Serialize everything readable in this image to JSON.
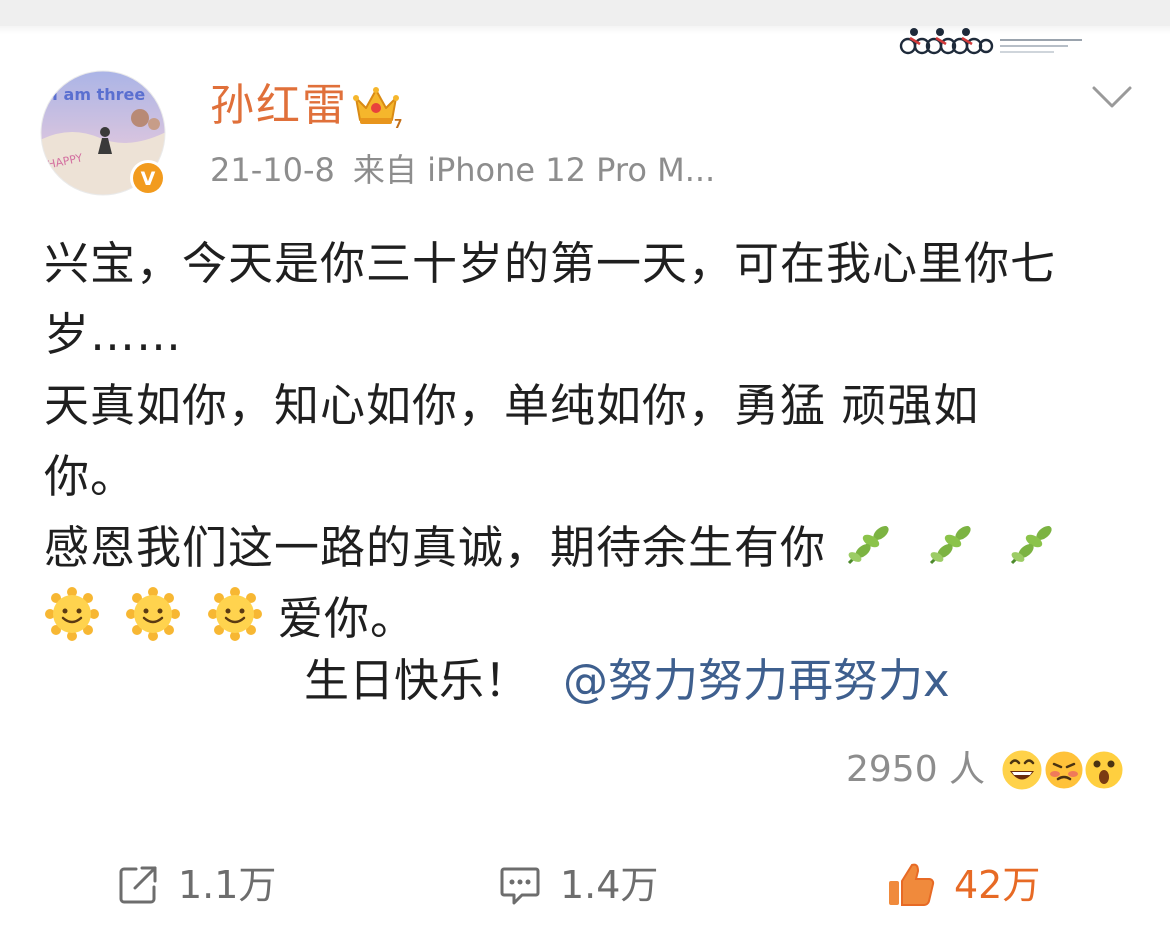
{
  "post": {
    "author": {
      "name": "孙红雷",
      "avatar_text": "I am three",
      "avatar_corner_text": "HAPPY",
      "badge": "V",
      "crown_icon": "crown-icon"
    },
    "meta": {
      "date": "21-10-8",
      "source": "来自 iPhone 12 Pro M..."
    },
    "body": {
      "line1": "兴宝，今天是你三十岁的第一天，可在我心里你七",
      "line2": "岁……",
      "line3": "天真如你，知心如你，单纯如你，勇猛 顽强如",
      "line4": "你。",
      "line5_text": "感恩我们这一路的真诚，期待余生有你",
      "line5_emojis": [
        "leaf-emoji",
        "leaf-emoji",
        "leaf-emoji"
      ],
      "line6_emojis": [
        "sun-face-emoji",
        "sun-face-emoji",
        "sun-face-emoji"
      ],
      "line6_text": "爱你。",
      "birthday_text": "生日快乐！",
      "mention": "@努力努力再努力x"
    },
    "reactions": {
      "count": "2950 人",
      "faces": [
        "laughing-face-icon",
        "blushing-face-icon",
        "surprised-face-icon"
      ]
    },
    "actions": {
      "repost": {
        "icon": "share-icon",
        "label": "1.1万"
      },
      "comment": {
        "icon": "comment-icon",
        "label": "1.4万"
      },
      "like": {
        "icon": "thumbs-up-icon",
        "label": "42万"
      }
    }
  },
  "colors": {
    "author_name": "#e0703a",
    "mention": "#3e5f8e",
    "like_accent": "#e76a25",
    "meta_gray": "#8d8d8d",
    "body_text": "#1f1f1f",
    "verified_badge": "#f29b1e"
  }
}
